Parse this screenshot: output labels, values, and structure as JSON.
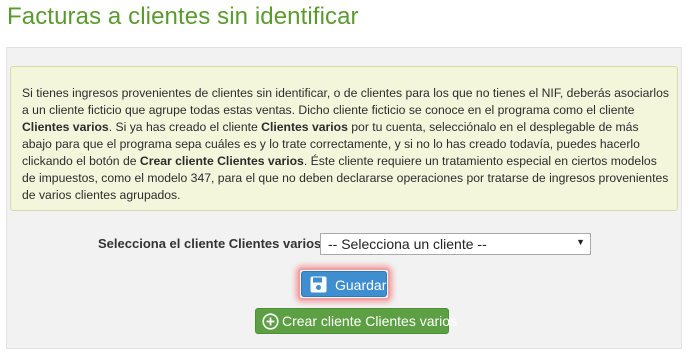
{
  "page": {
    "title": "Facturas a clientes sin identificar"
  },
  "info": {
    "p1": "Si tienes ingresos provenientes de clientes sin identificar, o de clientes para los que no tienes el NIF, deberás asociarlos a un cliente ficticio que agrupe todas estas ventas. Dicho cliente ficticio se conoce en el programa como el cliente ",
    "b1": "Clientes varios",
    "p2": ". Si ya has creado el cliente ",
    "b2": "Clientes varios",
    "p3": " por tu cuenta, selecciónalo en el desplegable de más abajo para que el programa sepa cuáles es y lo trate correctamente, y si no lo has creado todavía, puedes hacerlo clickando el botón de ",
    "b3": "Crear cliente Clientes varios",
    "p4": ". Éste cliente requiere un tratamiento especial en ciertos modelos de impuestos, como el modelo 347, para el que no deben declararse operaciones por tratarse de ingresos provenientes de varios clientes agrupados."
  },
  "client_select": {
    "label": "Selecciona el cliente Clientes varios:",
    "selected": "-- Selecciona un cliente --",
    "arrow": "▼"
  },
  "buttons": {
    "save_label": "Guardar",
    "create_label": "Crear cliente Clientes varios"
  },
  "icons": {
    "save": "floppy-disk-icon",
    "create": "plus-circle-icon"
  },
  "colors": {
    "title": "#5b9a2f",
    "save_button": "#3e8ed0",
    "create_button": "#5da044",
    "info_bg": "#f4f6dc"
  }
}
